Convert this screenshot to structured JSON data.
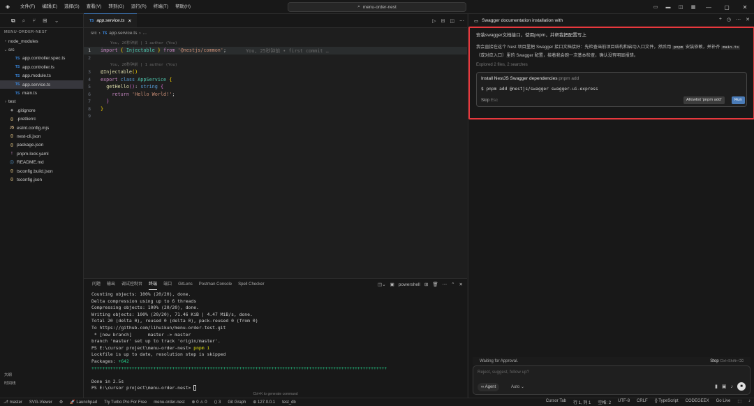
{
  "menubar": {
    "items": [
      "文件(F)",
      "编辑(E)",
      "选择(S)",
      "查看(V)",
      "转到(G)",
      "运行(R)",
      "终端(T)",
      "帮助(H)"
    ],
    "search_text": "menu-order-nest"
  },
  "explorer": {
    "header": "MENU-ORDER-NEST",
    "items": [
      {
        "label": "node_modules",
        "type": "folder-closed",
        "icon": ""
      },
      {
        "label": "src",
        "type": "folder-open",
        "icon": ""
      },
      {
        "label": "app.controller.spec.ts",
        "type": "ts",
        "icon": "TS"
      },
      {
        "label": "app.controller.ts",
        "type": "ts",
        "icon": "TS"
      },
      {
        "label": "app.module.ts",
        "type": "ts",
        "icon": "TS"
      },
      {
        "label": "app.service.ts",
        "type": "ts",
        "icon": "TS",
        "selected": true
      },
      {
        "label": "main.ts",
        "type": "ts",
        "icon": "TS"
      },
      {
        "label": "test",
        "type": "folder-closed",
        "icon": ""
      },
      {
        "label": ".gitignore",
        "type": "git",
        "icon": "◆"
      },
      {
        "label": ".prettierrc",
        "type": "json",
        "icon": "{}"
      },
      {
        "label": "eslint.config.mjs",
        "type": "js",
        "icon": "JS"
      },
      {
        "label": "nest-cli.json",
        "type": "json",
        "icon": "{}"
      },
      {
        "label": "package.json",
        "type": "json",
        "icon": "{}"
      },
      {
        "label": "pnpm-lock.yaml",
        "type": "yaml",
        "icon": "!"
      },
      {
        "label": "README.md",
        "type": "md",
        "icon": "ⓘ"
      },
      {
        "label": "tsconfig.build.json",
        "type": "json",
        "icon": "{}"
      },
      {
        "label": "tsconfig.json",
        "type": "json",
        "icon": "{}"
      }
    ],
    "outline": "大纲",
    "timeline": "时间线"
  },
  "editor": {
    "tab_label": "app.service.ts",
    "tab_icon": "TS",
    "breadcrumb": [
      "src",
      "app.service.ts",
      "..."
    ],
    "lens_1": "You, 26秒钟前 | 1 author (You)",
    "lens_2": "You, 26秒钟前 | 1 author (You)",
    "blame": "You, 25秒钟前 • first commit …",
    "line_numbers": [
      "1",
      "2",
      "3",
      "4",
      "5",
      "6",
      "7",
      "8",
      "9"
    ]
  },
  "panel": {
    "tabs": [
      "问题",
      "输出",
      "调试控制台",
      "终端",
      "端口",
      "GitLens",
      "Postman Console",
      "Spell Checker"
    ],
    "active_tab": "终端",
    "shell": "powershell",
    "lines": [
      "Counting objects: 100% (20/20), done.",
      "Delta compression using up to 6 threads",
      "Compressing objects: 100% (20/20), done.",
      "Writing objects: 100% (20/20), 71.46 KiB | 4.47 MiB/s, done.",
      "Total 20 (delta 0), reused 0 (delta 0), pack-reused 0 (from 0)",
      "To https://github.com/lihuikun/menu-order-test.git",
      " * [new branch]      master -> master",
      "branch 'master' set up to track 'origin/master'.",
      "PS E:\\cursor project\\menu-order-nest> pnpm i",
      "Lockfile is up to date, resolution step is skipped",
      "Packages: +642",
      "++++++++++++++++++++++++++++++++++++++++++++++++++++++++++++++++++++++++++++++++++++++++++++++++++++++++++++++",
      "",
      "Done in 2.5s",
      "PS E:\\cursor project\\menu-order-nest> "
    ],
    "hint": "Ctrl+K to generate command"
  },
  "ai": {
    "title": "Swagger documentation installation with",
    "user_message": "安装swagger文档接口，使用pnpm，并帮我把配置写上",
    "reply_1": "我会直接在这个 Nest 项目里把 Swagger 接口文档接好：先检查当前项目结构和启动入口文件，然后用",
    "reply_code_1": "pnpm",
    "reply_2": "安装依赖，并补齐",
    "reply_code_2": "main.ts",
    "reply_3": "（或对应入口）里的 Swagger 配置，接着我会跑一次基本检查，确认没有明显报错。",
    "explored": "Explored 2 files, 2 searches",
    "card_title": "Install NestJS Swagger dependencies",
    "card_sub": "pnpm add",
    "card_cmd": "$ pnpm add @nestjs/swagger swagger-ui-express",
    "skip": "Skip",
    "skip_key": "Esc",
    "allowlist": "Allowlist 'pnpm add'",
    "run": "Run",
    "waiting": "Waiting for Approval.",
    "stop": "Stop",
    "stop_key": "Ctrl+Shift+⌫",
    "placeholder": "Reject, suggest, follow up?",
    "agent": "∞ Agent",
    "auto": "Auto"
  },
  "status": {
    "left": [
      "⎇ master",
      "SVG-Viewer",
      "⚙",
      "🚀 Launchpad",
      "Try Turbo Pro For Free",
      "menu-order-nest",
      "⊗ 0 ⚠ 0",
      "⟨⟩ 3",
      "Git Graph",
      "⊕ 127.0.0.1",
      "test_db"
    ],
    "right": [
      "Cursor Tab",
      "行 1, 列 1",
      "空格: 2",
      "UTF-8",
      "CRLF",
      "{} TypeScript",
      "CODEGEEX",
      "Go Live",
      "⬚",
      "♪"
    ]
  }
}
